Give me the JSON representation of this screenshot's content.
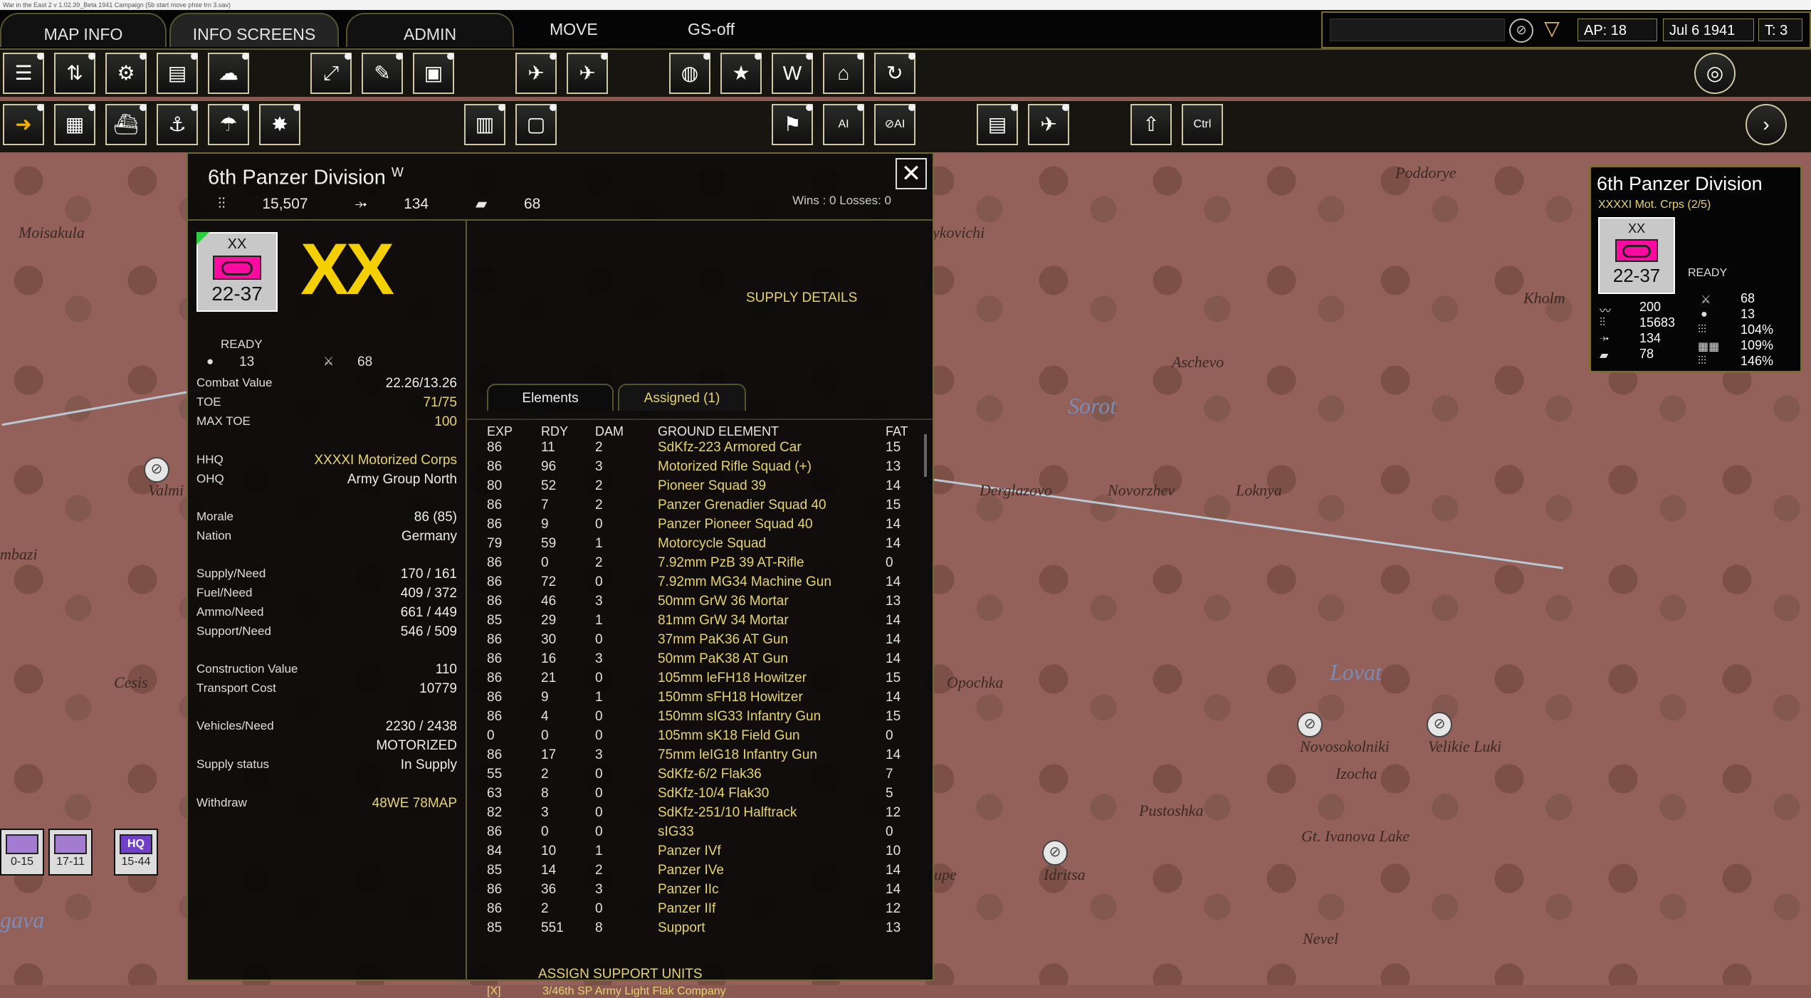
{
  "titlebar": {
    "text": "War in the East 2  v 1.02.39_Beta     1941 Campaign     (5b start move phse trn 3.sav)"
  },
  "menu": {
    "tabs": [
      "MAP INFO",
      "INFO SCREENS",
      "ADMIN"
    ],
    "active_tab": "INFO SCREENS",
    "items": [
      "MOVE",
      "GS-off"
    ]
  },
  "status": {
    "ap": "AP: 18",
    "date": "Jul 6 1941",
    "turn": "T: 3"
  },
  "map": {
    "labels": [
      "Moisakula",
      "Valmi",
      "mbazi",
      "Cesis",
      "gava",
      "ykovichi",
      "Poddorye",
      "Kholm",
      "Aschevo",
      "Sorot",
      "Derglazovo",
      "Novorzhev",
      "Loknya",
      "Opochka",
      "Lovat",
      "Novosokolniki",
      "Velikie Luki",
      "Izocha",
      "Pustoshka",
      "Gt. Ivanova Lake",
      "Idritsa",
      "upe",
      "Nevel"
    ]
  },
  "map_counters": [
    {
      "label": "0-15",
      "type": "XX"
    },
    {
      "label": "17-11",
      "type": "XX"
    },
    {
      "label": "15-44",
      "type": "XXX",
      "code": "HQ"
    }
  ],
  "panel": {
    "unit_name": "6th Panzer Division",
    "unit_superscript": "W",
    "men": "15,507",
    "guns": "134",
    "afv": "68",
    "wins_losses": "Wins : 0   Losses: 0",
    "close": "✕",
    "counter_type": "XX",
    "counter_numbers": "22-37",
    "size_symbol": "XX",
    "status": "READY",
    "mp": "13",
    "cv_icon_val": "68",
    "stats": [
      {
        "label": "Combat Value",
        "value": "22.26/13.26"
      },
      {
        "label": "TOE",
        "value": "71/75"
      },
      {
        "label": "MAX TOE",
        "value": "100"
      },
      {
        "label": "HHQ",
        "value": "XXXXI Motorized Corps"
      },
      {
        "label": "OHQ",
        "value": "Army Group North"
      },
      {
        "label": "Morale",
        "value": "86 (85)"
      },
      {
        "label": "Nation",
        "value": "Germany"
      },
      {
        "label": "Supply/Need",
        "value": "170 / 161"
      },
      {
        "label": "Fuel/Need",
        "value": "409 / 372"
      },
      {
        "label": "Ammo/Need",
        "value": "661 / 449"
      },
      {
        "label": "Support/Need",
        "value": "546 / 509"
      },
      {
        "label": "Construction Value",
        "value": "110"
      },
      {
        "label": "Transport Cost",
        "value": "10779"
      },
      {
        "label": "Vehicles/Need",
        "value": "2230 / 2438"
      },
      {
        "label": "",
        "value": "MOTORIZED"
      },
      {
        "label": "Supply status",
        "value": "In Supply"
      },
      {
        "label": "Withdraw",
        "value": "48WE  78MAP"
      }
    ],
    "supply_details": "SUPPLY DETAILS",
    "subtabs": [
      "Elements",
      "Assigned (1)"
    ],
    "columns": [
      "EXP",
      "RDY",
      "DAM",
      "GROUND ELEMENT",
      "FAT"
    ],
    "elements": [
      {
        "exp": "86",
        "rdy": "11",
        "dam": "2",
        "name": "SdKfz-223 Armored Car",
        "fat": "15"
      },
      {
        "exp": "86",
        "rdy": "96",
        "dam": "3",
        "name": "Motorized Rifle Squad (+)",
        "fat": "13"
      },
      {
        "exp": "80",
        "rdy": "52",
        "dam": "2",
        "name": "Pioneer Squad 39",
        "fat": "14"
      },
      {
        "exp": "86",
        "rdy": "7",
        "dam": "2",
        "name": "Panzer Grenadier Squad 40",
        "fat": "15"
      },
      {
        "exp": "86",
        "rdy": "9",
        "dam": "0",
        "name": "Panzer Pioneer Squad 40",
        "fat": "14"
      },
      {
        "exp": "79",
        "rdy": "59",
        "dam": "1",
        "name": "Motorcycle Squad",
        "fat": "14"
      },
      {
        "exp": "86",
        "rdy": "0",
        "dam": "2",
        "name": "7.92mm PzB 39 AT-Rifle",
        "fat": "0"
      },
      {
        "exp": "86",
        "rdy": "72",
        "dam": "0",
        "name": "7.92mm MG34 Machine Gun",
        "fat": "14"
      },
      {
        "exp": "86",
        "rdy": "46",
        "dam": "3",
        "name": "50mm GrW 36 Mortar",
        "fat": "13"
      },
      {
        "exp": "85",
        "rdy": "29",
        "dam": "1",
        "name": "81mm GrW 34 Mortar",
        "fat": "14"
      },
      {
        "exp": "86",
        "rdy": "30",
        "dam": "0",
        "name": "37mm PaK36 AT Gun",
        "fat": "14"
      },
      {
        "exp": "86",
        "rdy": "16",
        "dam": "3",
        "name": "50mm PaK38 AT Gun",
        "fat": "14"
      },
      {
        "exp": "86",
        "rdy": "21",
        "dam": "0",
        "name": "105mm leFH18 Howitzer",
        "fat": "15"
      },
      {
        "exp": "86",
        "rdy": "9",
        "dam": "1",
        "name": "150mm sFH18 Howitzer",
        "fat": "14"
      },
      {
        "exp": "86",
        "rdy": "4",
        "dam": "0",
        "name": "150mm sIG33 Infantry Gun",
        "fat": "15"
      },
      {
        "exp": "0",
        "rdy": "0",
        "dam": "0",
        "name": "105mm sK18 Field Gun",
        "fat": "0"
      },
      {
        "exp": "86",
        "rdy": "17",
        "dam": "3",
        "name": "75mm leIG18 Infantry Gun",
        "fat": "14"
      },
      {
        "exp": "55",
        "rdy": "2",
        "dam": "0",
        "name": "SdKfz-6/2 Flak36",
        "fat": "7"
      },
      {
        "exp": "63",
        "rdy": "8",
        "dam": "0",
        "name": "SdKfz-10/4 Flak30",
        "fat": "5"
      },
      {
        "exp": "82",
        "rdy": "3",
        "dam": "0",
        "name": "SdKfz-251/10 Halftrack",
        "fat": "12"
      },
      {
        "exp": "86",
        "rdy": "0",
        "dam": "0",
        "name": "sIG33",
        "fat": "0"
      },
      {
        "exp": "84",
        "rdy": "10",
        "dam": "1",
        "name": "Panzer IVf",
        "fat": "10"
      },
      {
        "exp": "85",
        "rdy": "14",
        "dam": "2",
        "name": "Panzer IVe",
        "fat": "14"
      },
      {
        "exp": "86",
        "rdy": "36",
        "dam": "3",
        "name": "Panzer IIc",
        "fat": "14"
      },
      {
        "exp": "86",
        "rdy": "2",
        "dam": "0",
        "name": "Panzer IIf",
        "fat": "12"
      },
      {
        "exp": "85",
        "rdy": "551",
        "dam": "8",
        "name": "Support",
        "fat": "13"
      }
    ],
    "assign_support": "ASSIGN SUPPORT UNITS",
    "assigned_marker": "[X]",
    "assigned_unit": "3/46th SP Army Light Flak Company"
  },
  "info_panel": {
    "title": "6th Panzer Division",
    "subtitle": "XXXXI Mot. Crps (2/5)",
    "counter_type": "XX",
    "counter_numbers": "22-37",
    "status": "READY",
    "left": [
      "200",
      "15683",
      "134",
      "78"
    ],
    "right": [
      "68",
      "13",
      "104%",
      "109%",
      "146%"
    ]
  }
}
